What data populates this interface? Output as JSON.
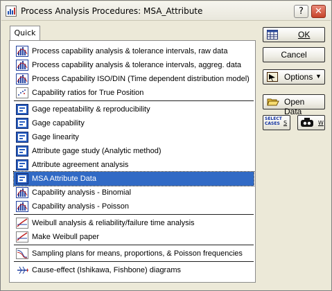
{
  "window": {
    "title": "Process Analysis Procedures: MSA_Attribute",
    "help_glyph": "?",
    "close_glyph": "✕"
  },
  "tabs": [
    {
      "label": "Quick"
    }
  ],
  "items": [
    {
      "label": "Process capability analysis & tolerance intervals, raw data",
      "icon": "histogram-icon"
    },
    {
      "label": "Process capability analysis & tolerance intervals, aggreg. data",
      "icon": "histogram-icon"
    },
    {
      "label": "Process Capability  ISO/DIN (Time dependent distribution model)",
      "icon": "histogram-icon"
    },
    {
      "label": "Capability ratios for True Position",
      "icon": "scatter-icon"
    },
    {
      "label": "Gage repeatability & reproducibility",
      "icon": "gage-icon"
    },
    {
      "label": "Gage capability",
      "icon": "gage-icon"
    },
    {
      "label": "Gage linearity",
      "icon": "gage-icon"
    },
    {
      "label": "Attribute gage study (Analytic method)",
      "icon": "gage-icon"
    },
    {
      "label": "Attribute agreement analysis",
      "icon": "gage-icon"
    },
    {
      "label": "MSA Attribute Data",
      "icon": "gage-icon"
    },
    {
      "label": "Capability analysis - Binomial",
      "icon": "histogram-icon"
    },
    {
      "label": "Capability analysis - Poisson",
      "icon": "histogram-icon"
    },
    {
      "label": "Weibull analysis & reliability/failure time analysis",
      "icon": "weibull-icon"
    },
    {
      "label": "Make Weibull paper",
      "icon": "weibull-icon"
    },
    {
      "label": "Sampling plans for means, proportions, & Poisson frequencies",
      "icon": "sampling-icon"
    },
    {
      "label": "Cause-effect (Ishikawa, Fishbone) diagrams",
      "icon": "fishbone-icon"
    }
  ],
  "selected_item": "MSA Attribute Data",
  "buttons": {
    "ok": "OK",
    "cancel": "Cancel",
    "options": "Options",
    "options_arrow": "▼",
    "open_data": "Open Data",
    "select_cases_line1": "SELECT",
    "select_cases_line2": "CASES",
    "select_cases_key": "S",
    "weight_key": "W"
  },
  "colors": {
    "selection": "#316ac5",
    "panel_bg": "#ffffff",
    "dialog_bg": "#ece9d8"
  }
}
